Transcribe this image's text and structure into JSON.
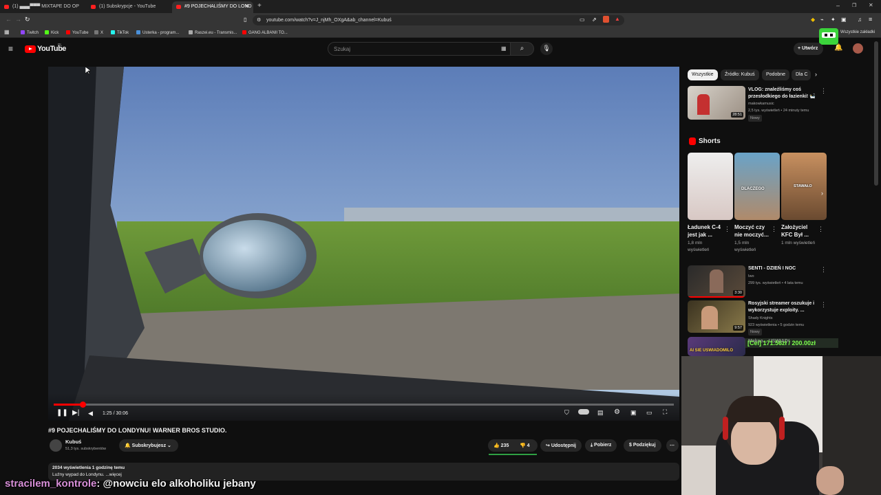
{
  "browser": {
    "tabs": [
      {
        "label": "(1) ▄▄▄▀▀▀ MIXTAPE DO OP"
      },
      {
        "label": "(1) Subskrypcje - YouTube"
      },
      {
        "label": "#9 POJECHALIŚMY DO LOND"
      }
    ],
    "url": "youtube.com/watch?v=J_njMh_OXgA&ab_channel=Kubuś",
    "bookmarks": [
      "Twitch",
      "Kick",
      "YouTube",
      "X",
      "TikTok",
      "Usterka - program...",
      "Raszei.eu - Transmis...",
      "GANG ALBANII TO..."
    ],
    "all_bookmarks": "Wszystkie zakładki"
  },
  "youtube": {
    "logo_text": "YouTube",
    "logo_region": "PL",
    "search_placeholder": "Szukaj",
    "create_label": "Utwórz"
  },
  "player": {
    "time": "1:25 / 30:06",
    "progress": 0.047
  },
  "video": {
    "title": "#9 POJECHALIŚMY DO LONDYNU! WARNER BROS STUDIO.",
    "channel": "Kubuś",
    "subscribers": "51,3 tys. subskrybentów",
    "subscribed_label": "Subskrybujesz",
    "likes": "235",
    "dislike_count": "4",
    "share_label": "Udostępnij",
    "download_label": "Pobierz",
    "thanks_label": "Podziękuj",
    "views_date": "2034 wyświetlenia  1 godzinę temu",
    "description": "Luźny wypad do Londynu. ...więcej"
  },
  "filter_chips": [
    "Wszystkie",
    "Źródło: Kubuś",
    "Podobne",
    "Dla C"
  ],
  "recommendations": [
    {
      "title": "VLOG: znaleźliśmy coś przesłodkiego do łazienki! 🛀",
      "channel": "makowkamusic",
      "meta": "2,5 tys. wyświetleń • 24 minuty temu",
      "badge": "Nowy",
      "duration": "28:51"
    },
    {
      "title": "SENTI - DZIEŃ I NOC",
      "channel": "Iwo",
      "meta": "299 tys. wyświetleń • 4 lata temu",
      "badge": "",
      "duration": "3:30"
    },
    {
      "title": "Rosyjski streamer oszukuje i wykorzystuje exploity. ...",
      "channel": "Shady Knights",
      "meta": "923 wyświetlenia • 5 godzin temu",
      "badge": "Nowy",
      "duration": "9:57"
    },
    {
      "title": "Makao... USWIADOMILO",
      "channel": "",
      "meta": "",
      "badge": "",
      "duration": ""
    }
  ],
  "shorts": {
    "heading": "Shorts",
    "items": [
      {
        "title": "Ładunek C-4 jest jak ...",
        "views": "1,8 mln wyświetleń",
        "overlay": ""
      },
      {
        "title": "Moczyć czy nie moczyć...",
        "views": "1,5 mln wyświetleń",
        "overlay": "DLACZEGO"
      },
      {
        "title": "Założyciel KFC Był ...",
        "views": "1 mln wyświetleń",
        "overlay": "STAWAŁO"
      }
    ]
  },
  "overlay": {
    "donation_goal": "[Cel] 171.56zł / 200.00zł",
    "thumb_caption": "AI SIE USWIADOMILO",
    "chat_user": "stracilem_kontrole",
    "chat_message": ": @nowciu elo alkoholiku jebany"
  },
  "colors": {
    "accent": "#ff0000",
    "background": "#0f0f0f",
    "donation": "#7cff4d",
    "chat_user": "#d88fd8"
  }
}
